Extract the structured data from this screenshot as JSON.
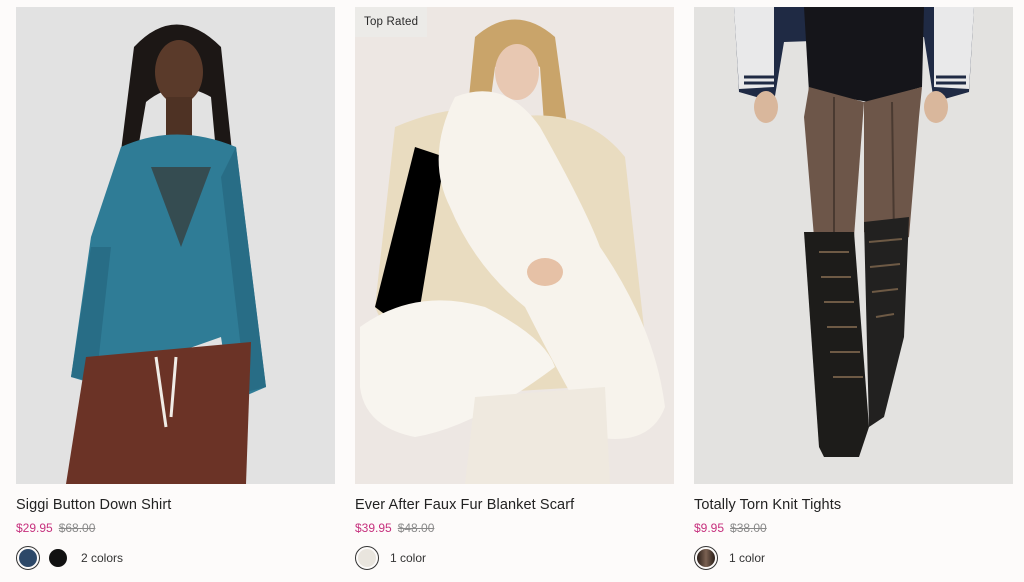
{
  "products": [
    {
      "name": "Siggi Button Down Shirt",
      "sale_price": "$29.95",
      "original_price": "$68.00",
      "color_count": "2 colors",
      "badge": "",
      "swatch_colors": [
        "#2d4868",
        "#111111"
      ],
      "image": "model-blue-mesh-shirt"
    },
    {
      "name": "Ever After Faux Fur Blanket Scarf",
      "sale_price": "$39.95",
      "original_price": "$48.00",
      "color_count": "1 color",
      "badge": "Top Rated",
      "swatch_colors": [
        "#e9e5de"
      ],
      "image": "model-cream-faux-fur-scarf"
    },
    {
      "name": "Totally Torn Knit Tights",
      "sale_price": "$9.95",
      "original_price": "$38.00",
      "color_count": "1 color",
      "badge": "",
      "swatch_colors": [
        "#3a2c25"
      ],
      "image": "model-knit-tights-boots"
    }
  ],
  "colors": {
    "sale_price": "#c6307d",
    "background": "#fdfbfa"
  }
}
